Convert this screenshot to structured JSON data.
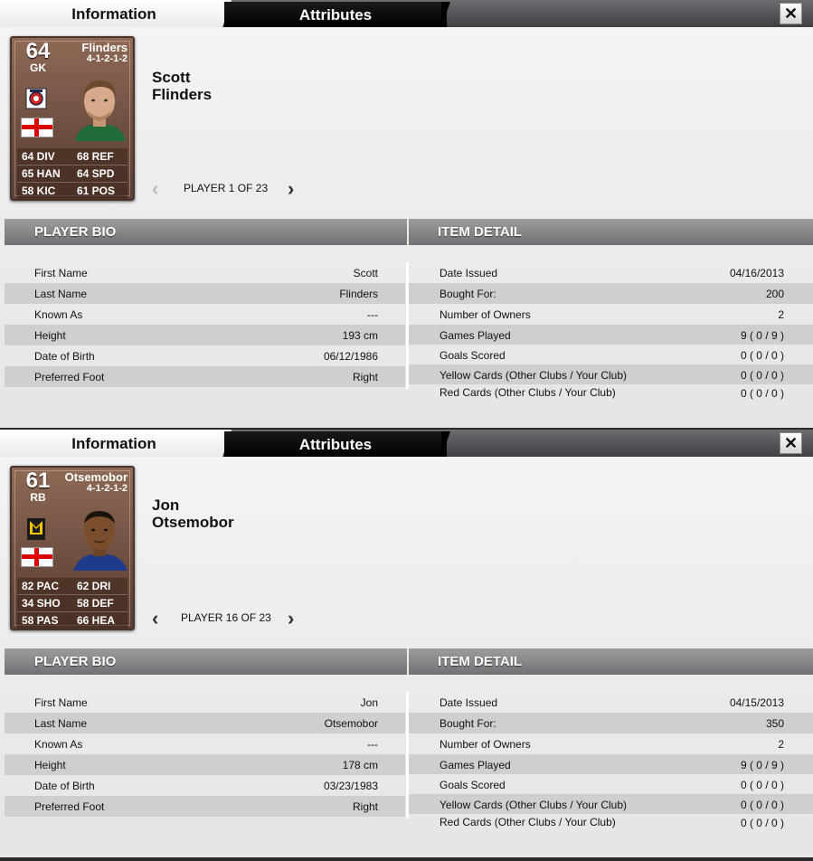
{
  "panels": [
    {
      "tabs": {
        "information": "Information",
        "attributes": "Attributes"
      },
      "close_label": "✕",
      "card": {
        "rating": "64",
        "position": "GK",
        "name": "Flinders",
        "formation": "4-1-2-1-2",
        "stats": [
          [
            "64 DIV",
            "68 REF"
          ],
          [
            "65 HAN",
            "64 SPD"
          ],
          [
            "58 KIC",
            "61 POS"
          ]
        ],
        "nation_flag": "england-flag-icon",
        "club_badge": "hartlepool-badge-icon"
      },
      "first_name": "Scott",
      "last_name": "Flinders",
      "pager": {
        "label": "PLAYER 1 OF 23"
      },
      "bio_header": "PLAYER BIO",
      "item_header": "ITEM DETAIL",
      "bio": {
        "first_name": {
          "label": "First Name",
          "value": "Scott"
        },
        "last_name": {
          "label": "Last Name",
          "value": "Flinders"
        },
        "known_as": {
          "label": "Known As",
          "value": "---"
        },
        "height": {
          "label": "Height",
          "value": "193 cm"
        },
        "dob": {
          "label": "Date of Birth",
          "value": "06/12/1986"
        },
        "foot": {
          "label": "Preferred Foot",
          "value": "Right"
        }
      },
      "item": {
        "date_issued": {
          "label": "Date Issued",
          "value": "04/16/2013"
        },
        "bought_for": {
          "label": "Bought For:",
          "value": "200"
        },
        "owners": {
          "label": "Number of Owners",
          "value": "2"
        },
        "games": {
          "label": "Games Played",
          "value": "9 ( 0 / 9 )"
        },
        "goals": {
          "label": "Goals Scored",
          "value": "0 ( 0 / 0 )"
        },
        "yellow": {
          "label": "Yellow Cards (Other Clubs / Your Club)",
          "value": "0 ( 0 / 0 )"
        },
        "red": {
          "label": "Red Cards (Other Clubs / Your Club)",
          "value": "0 ( 0 / 0 )"
        }
      }
    },
    {
      "tabs": {
        "information": "Information",
        "attributes": "Attributes"
      },
      "close_label": "✕",
      "card": {
        "rating": "61",
        "position": "RB",
        "name": "Otsemobor",
        "formation": "4-1-2-1-2",
        "stats": [
          [
            "82 PAC",
            "62 DRI"
          ],
          [
            "34 SHO",
            "58 DEF"
          ],
          [
            "58 PAS",
            "66 HEA"
          ]
        ],
        "nation_flag": "england-flag-icon",
        "club_badge": "mk-dons-badge-icon"
      },
      "first_name": "Jon",
      "last_name": "Otsemobor",
      "pager": {
        "label": "PLAYER 16 OF 23"
      },
      "bio_header": "PLAYER BIO",
      "item_header": "ITEM DETAIL",
      "bio": {
        "first_name": {
          "label": "First Name",
          "value": "Jon"
        },
        "last_name": {
          "label": "Last Name",
          "value": "Otsemobor"
        },
        "known_as": {
          "label": "Known As",
          "value": "---"
        },
        "height": {
          "label": "Height",
          "value": "178 cm"
        },
        "dob": {
          "label": "Date of Birth",
          "value": "03/23/1983"
        },
        "foot": {
          "label": "Preferred Foot",
          "value": "Right"
        }
      },
      "item": {
        "date_issued": {
          "label": "Date Issued",
          "value": "04/15/2013"
        },
        "bought_for": {
          "label": "Bought For:",
          "value": "350"
        },
        "owners": {
          "label": "Number of Owners",
          "value": "2"
        },
        "games": {
          "label": "Games Played",
          "value": "9 ( 0 / 9 )"
        },
        "goals": {
          "label": "Goals Scored",
          "value": "0 ( 0 / 0 )"
        },
        "yellow": {
          "label": "Yellow Cards (Other Clubs / Your Club)",
          "value": "0 ( 0 / 0 )"
        },
        "red": {
          "label": "Red Cards (Other Clubs / Your Club)",
          "value": "0 ( 0 / 0 )"
        }
      }
    }
  ]
}
